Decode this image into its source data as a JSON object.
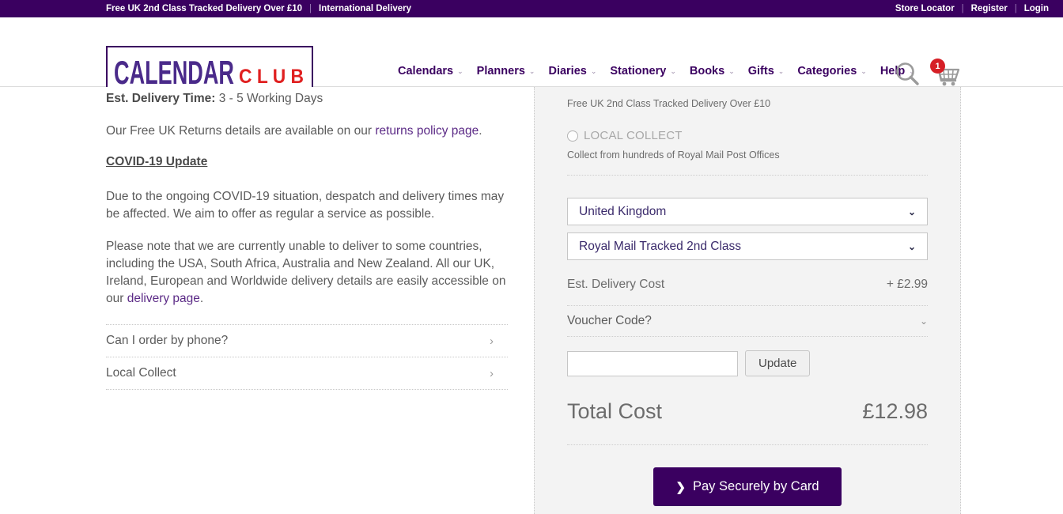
{
  "topbar": {
    "promo": "Free UK 2nd Class Tracked Delivery Over £10",
    "separator": "|",
    "international": "International Delivery",
    "store_locator": "Store Locator",
    "register": "Register",
    "login": "Login"
  },
  "header": {
    "logo": {
      "primary": "CALENDAR",
      "secondary": "C L U B"
    },
    "nav": [
      {
        "label": "Calendars",
        "caret": "⌄"
      },
      {
        "label": "Planners",
        "caret": "⌄"
      },
      {
        "label": "Diaries",
        "caret": "⌄"
      },
      {
        "label": "Stationery",
        "caret": "⌄"
      },
      {
        "label": "Books",
        "caret": "⌄"
      },
      {
        "label": "Gifts",
        "caret": "⌄"
      },
      {
        "label": "Categories",
        "caret": "⌄"
      },
      {
        "label": "Help",
        "caret": "⌄"
      }
    ],
    "search_icon": "search-icon",
    "cart_icon": "cart-icon",
    "cart_count": "1"
  },
  "left": {
    "delivery_time_label": "Est. Delivery Time:",
    "delivery_time_value": " 3 - 5 Working Days",
    "returns_prefix": "Our Free UK Returns details are available on our ",
    "returns_link": "returns policy page",
    "returns_suffix": ".",
    "covid_heading": "COVID-19 Update",
    "covid_para_1": "Due to the ongoing COVID-19 situation, despatch and delivery times may be affected. We aim to offer as regular a service as possible.",
    "covid_para_2_prefix": "Please note that we are currently unable to deliver to some countries, including the USA, South Africa, Australia and New Zealand. All our UK, Ireland, European and Worldwide delivery details are easily accessible on our ",
    "covid_para_2_link": "delivery page",
    "covid_para_2_suffix": ".",
    "accordion": [
      {
        "label": "Can I order by phone?",
        "chevron": "›"
      },
      {
        "label": "Local Collect",
        "chevron": "›"
      }
    ]
  },
  "right": {
    "free_delivery_note": "Free UK 2nd Class Tracked Delivery Over £10",
    "local_collect_label": "LOCAL COLLECT",
    "local_collect_note": "Collect from hundreds of Royal Mail Post Offices",
    "country_select": {
      "value": "United Kingdom",
      "chevron": "⌄",
      "options": [
        "United Kingdom"
      ]
    },
    "method_select": {
      "value": "Royal Mail Tracked 2nd Class",
      "chevron": "⌄",
      "options": [
        "Royal Mail Tracked 2nd Class"
      ]
    },
    "delivery_cost_label": "Est. Delivery Cost",
    "delivery_cost_value": "+ £2.99",
    "voucher_label": "Voucher Code?",
    "voucher_chevron": "⌄",
    "voucher_input_value": "",
    "voucher_input_placeholder": "",
    "update_button": "Update",
    "total_label": "Total Cost",
    "total_value": "£12.98",
    "pay_button": "Pay Securely by Card",
    "pay_chevron": "❯"
  },
  "colors": {
    "brand_purple": "#3a0060",
    "accent_red": "#d61f26",
    "panel_bg": "#f3f3f3",
    "body_text": "#5b5b5b"
  }
}
